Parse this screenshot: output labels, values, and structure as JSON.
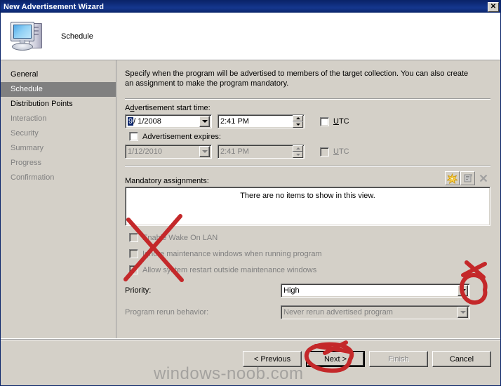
{
  "window": {
    "title": "New Advertisement Wizard",
    "close_label": "✕"
  },
  "header": {
    "title": "Schedule",
    "icon": "computer-icon"
  },
  "sidebar": {
    "items": [
      {
        "label": "General",
        "state": "normal"
      },
      {
        "label": "Schedule",
        "state": "selected"
      },
      {
        "label": "Distribution Points",
        "state": "normal"
      },
      {
        "label": "Interaction",
        "state": "dim"
      },
      {
        "label": "Security",
        "state": "dim"
      },
      {
        "label": "Summary",
        "state": "dim"
      },
      {
        "label": "Progress",
        "state": "dim"
      },
      {
        "label": "Confirmation",
        "state": "dim"
      }
    ]
  },
  "main": {
    "intro": "Specify when the program will be advertised to members of the target collection. You can also create an assignment to make the program mandatory.",
    "start_time": {
      "label": "Advertisement start time:",
      "date_selected_part": "9",
      "date_rest": "/ 1/2008",
      "time_value": "2:41 PM",
      "utc_label": "UTC",
      "utc_checked": false
    },
    "expires": {
      "checkbox_label": "Advertisement expires:",
      "checked": false,
      "date_value": "1/12/2010",
      "time_value": "2:41 PM",
      "utc_label": "UTC",
      "utc_checked": false
    },
    "mandatory": {
      "label": "Mandatory assignments:",
      "empty_text": "There are no items to show in this view.",
      "toolbar": [
        {
          "name": "new-assignment-icon",
          "enabled": true
        },
        {
          "name": "properties-icon",
          "enabled": false
        },
        {
          "name": "delete-icon",
          "enabled": false
        }
      ]
    },
    "options": [
      {
        "label": "Enable Wake On LAN",
        "accel": "W",
        "checked": false,
        "enabled": false
      },
      {
        "label": "Ignore maintenance windows when running program",
        "accel": "o",
        "checked": false,
        "enabled": false
      },
      {
        "label": "Allow system restart outside maintenance windows",
        "accel": "e",
        "checked": false,
        "enabled": false
      }
    ],
    "priority": {
      "label": "Priority:",
      "value": "High",
      "enabled": true
    },
    "rerun": {
      "label": "Program rerun behavior:",
      "value": "Never rerun advertised program",
      "enabled": false
    }
  },
  "footer": {
    "buttons": [
      {
        "label": "< Previous",
        "state": "normal",
        "name": "previous-button"
      },
      {
        "label": "Next >",
        "state": "default",
        "name": "next-button"
      },
      {
        "label": "Finish",
        "state": "disabled",
        "name": "finish-button"
      },
      {
        "label": "Cancel",
        "state": "normal",
        "name": "cancel-button"
      }
    ]
  },
  "watermark": {
    "text": "windows-noob.com"
  },
  "annotations": {
    "color": "#c4282a",
    "marks": [
      {
        "name": "red-x-over-checkboxes",
        "type": "x"
      },
      {
        "name": "red-circle-priority-dropdown",
        "type": "circle"
      },
      {
        "name": "red-circle-next-button",
        "type": "circle"
      }
    ]
  }
}
